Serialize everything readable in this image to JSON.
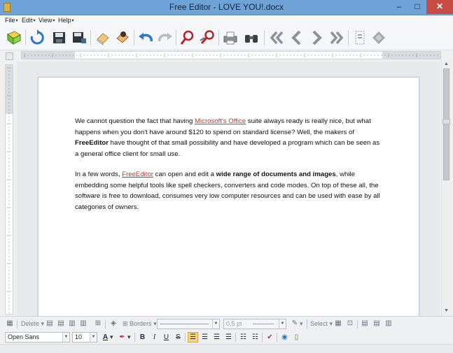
{
  "window": {
    "title": "Free Editor - LOVE YOU!.docx",
    "minimize": "–",
    "maximize": "□",
    "close": "✕"
  },
  "menu": [
    {
      "label": "File"
    },
    {
      "label": "Edit"
    },
    {
      "label": "View"
    },
    {
      "label": "Help"
    }
  ],
  "toolbar_icons": [
    "new-document",
    "refresh",
    "save",
    "save-as",
    "eraser",
    "paste-special",
    "undo",
    "redo",
    "find",
    "find-replace",
    "print",
    "binoculars",
    "first-page",
    "previous-page",
    "next-page",
    "last-page",
    "page-view",
    "diamond"
  ],
  "document": {
    "paragraph1": {
      "before_link": "We cannot question the fact that having ",
      "link": "Microsoft's Office",
      "after_link": " suite always ready is really nice, but what happens when you don't have around $120 to spend on standard license? Well, the makers of ",
      "bold": "FreeEditor",
      "end": " have thought of that small possibility and have developed a program which can be seen as a general office client for small use."
    },
    "paragraph2": {
      "before_link": "In a few words, ",
      "link": "FreeEditor",
      "middle": " can open and edit a ",
      "bold": "wide range of documents and images",
      "end": ", while embedding some helpful tools like spell checkers, converters and code modes. On top of these all, the software is free to download, consumes very low computer resources and can be used with ease by all categories of owners."
    }
  },
  "table_toolbar": {
    "delete_label": "Delete",
    "borders_label": "Borders",
    "line_width": "0.5 pt",
    "select_label": "Select"
  },
  "format_toolbar": {
    "font_name": "Open Sans",
    "font_size": "10",
    "bold": "B",
    "italic": "I",
    "underline": "U",
    "strikethrough": "S"
  },
  "colors": {
    "title_bar": "#6fa3d8",
    "close_button": "#c74c45",
    "link": "#c0392b",
    "active_align": "#f7d67a"
  }
}
